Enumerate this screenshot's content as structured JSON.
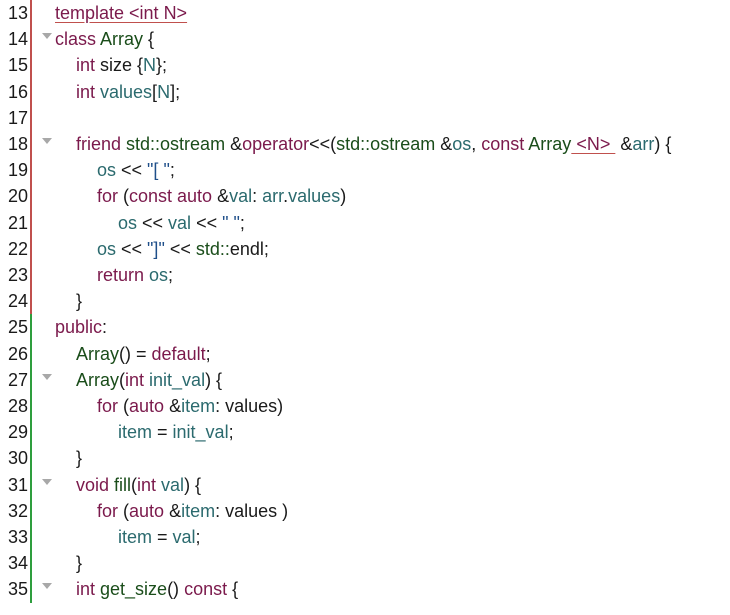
{
  "editor": {
    "lines": [
      {
        "n": "13",
        "fold": false,
        "indent": 0,
        "tokens": [
          {
            "t": "template <int N>",
            "c": "kw",
            "u": true
          }
        ]
      },
      {
        "n": "14",
        "fold": true,
        "indent": 0,
        "tokens": [
          {
            "t": "class ",
            "c": "kw"
          },
          {
            "t": "Array",
            "c": "ty"
          },
          {
            "t": " {",
            "c": "pl"
          }
        ]
      },
      {
        "n": "15",
        "fold": false,
        "indent": 1,
        "tokens": [
          {
            "t": "int ",
            "c": "kw"
          },
          {
            "t": "size ",
            "c": "pl"
          },
          {
            "t": "{",
            "c": "pl"
          },
          {
            "t": "N",
            "c": "var"
          },
          {
            "t": "};",
            "c": "pl"
          }
        ]
      },
      {
        "n": "16",
        "fold": false,
        "indent": 1,
        "tokens": [
          {
            "t": "int ",
            "c": "kw"
          },
          {
            "t": "values",
            "c": "var"
          },
          {
            "t": "[",
            "c": "pl"
          },
          {
            "t": "N",
            "c": "var"
          },
          {
            "t": "];",
            "c": "pl"
          }
        ]
      },
      {
        "n": "17",
        "fold": false,
        "indent": 0,
        "tokens": []
      },
      {
        "n": "18",
        "fold": true,
        "indent": 1,
        "tokens": [
          {
            "t": "friend ",
            "c": "kw"
          },
          {
            "t": "std::ostream ",
            "c": "ty"
          },
          {
            "t": "&",
            "c": "pl"
          },
          {
            "t": "operator",
            "c": "kw"
          },
          {
            "t": "<<(",
            "c": "pl"
          },
          {
            "t": "std::ostream ",
            "c": "ty"
          },
          {
            "t": "&",
            "c": "pl"
          },
          {
            "t": "os",
            "c": "var"
          },
          {
            "t": ", ",
            "c": "pl"
          },
          {
            "t": "const ",
            "c": "kw"
          },
          {
            "t": "Array",
            "c": "ty"
          },
          {
            "t": " <N> ",
            "c": "kw",
            "u": true
          },
          {
            "t": " &",
            "c": "pl"
          },
          {
            "t": "arr",
            "c": "var"
          },
          {
            "t": ") {",
            "c": "pl"
          }
        ]
      },
      {
        "n": "19",
        "fold": false,
        "indent": 2,
        "tokens": [
          {
            "t": "os ",
            "c": "var"
          },
          {
            "t": "<< ",
            "c": "pl"
          },
          {
            "t": "\"[ \"",
            "c": "str"
          },
          {
            "t": ";",
            "c": "pl"
          }
        ]
      },
      {
        "n": "20",
        "fold": false,
        "indent": 2,
        "tokens": [
          {
            "t": "for ",
            "c": "kw"
          },
          {
            "t": "(",
            "c": "pl"
          },
          {
            "t": "const auto ",
            "c": "kw"
          },
          {
            "t": "&",
            "c": "pl"
          },
          {
            "t": "val",
            "c": "var"
          },
          {
            "t": ": ",
            "c": "pl"
          },
          {
            "t": "arr",
            "c": "var"
          },
          {
            "t": ".",
            "c": "pl"
          },
          {
            "t": "values",
            "c": "var"
          },
          {
            "t": ")",
            "c": "pl"
          }
        ]
      },
      {
        "n": "21",
        "fold": false,
        "indent": 3,
        "tokens": [
          {
            "t": "os ",
            "c": "var"
          },
          {
            "t": "<< ",
            "c": "pl"
          },
          {
            "t": "val ",
            "c": "var"
          },
          {
            "t": "<< ",
            "c": "pl"
          },
          {
            "t": "\" \"",
            "c": "str"
          },
          {
            "t": ";",
            "c": "pl"
          }
        ]
      },
      {
        "n": "22",
        "fold": false,
        "indent": 2,
        "tokens": [
          {
            "t": "os ",
            "c": "var"
          },
          {
            "t": "<< ",
            "c": "pl"
          },
          {
            "t": "\"]\"",
            "c": "str"
          },
          {
            "t": " << ",
            "c": "pl"
          },
          {
            "t": "std::",
            "c": "ty"
          },
          {
            "t": "endl",
            "c": "pl"
          },
          {
            "t": ";",
            "c": "pl"
          }
        ]
      },
      {
        "n": "23",
        "fold": false,
        "indent": 2,
        "tokens": [
          {
            "t": "return ",
            "c": "kw"
          },
          {
            "t": "os",
            "c": "var"
          },
          {
            "t": ";",
            "c": "pl"
          }
        ]
      },
      {
        "n": "24",
        "fold": false,
        "indent": 1,
        "tokens": [
          {
            "t": "}",
            "c": "pl"
          }
        ]
      },
      {
        "n": "25",
        "fold": false,
        "indent": 0,
        "tokens": [
          {
            "t": "public",
            "c": "kw"
          },
          {
            "t": ":",
            "c": "pl"
          }
        ]
      },
      {
        "n": "26",
        "fold": false,
        "indent": 1,
        "tokens": [
          {
            "t": "Array",
            "c": "ty"
          },
          {
            "t": "() = ",
            "c": "pl"
          },
          {
            "t": "default",
            "c": "kw"
          },
          {
            "t": ";",
            "c": "pl"
          }
        ]
      },
      {
        "n": "27",
        "fold": true,
        "indent": 1,
        "tokens": [
          {
            "t": "Array",
            "c": "ty"
          },
          {
            "t": "(",
            "c": "pl"
          },
          {
            "t": "int ",
            "c": "kw"
          },
          {
            "t": "init_val",
            "c": "var"
          },
          {
            "t": ") {",
            "c": "pl"
          }
        ]
      },
      {
        "n": "28",
        "fold": false,
        "indent": 2,
        "tokens": [
          {
            "t": "for ",
            "c": "kw"
          },
          {
            "t": "(",
            "c": "pl"
          },
          {
            "t": "auto ",
            "c": "kw"
          },
          {
            "t": "&",
            "c": "pl"
          },
          {
            "t": "item",
            "c": "var"
          },
          {
            "t": ": values)",
            "c": "pl"
          }
        ]
      },
      {
        "n": "29",
        "fold": false,
        "indent": 3,
        "tokens": [
          {
            "t": "item ",
            "c": "var"
          },
          {
            "t": "= ",
            "c": "pl"
          },
          {
            "t": "init_val",
            "c": "var"
          },
          {
            "t": ";",
            "c": "pl"
          }
        ]
      },
      {
        "n": "30",
        "fold": false,
        "indent": 1,
        "tokens": [
          {
            "t": "}",
            "c": "pl"
          }
        ]
      },
      {
        "n": "31",
        "fold": true,
        "indent": 1,
        "tokens": [
          {
            "t": "void ",
            "c": "kw"
          },
          {
            "t": "fill",
            "c": "ty"
          },
          {
            "t": "(",
            "c": "pl"
          },
          {
            "t": "int ",
            "c": "kw"
          },
          {
            "t": "val",
            "c": "var"
          },
          {
            "t": ") {",
            "c": "pl"
          }
        ]
      },
      {
        "n": "32",
        "fold": false,
        "indent": 2,
        "tokens": [
          {
            "t": "for ",
            "c": "kw"
          },
          {
            "t": "(",
            "c": "pl"
          },
          {
            "t": "auto ",
            "c": "kw"
          },
          {
            "t": "&",
            "c": "pl"
          },
          {
            "t": "item",
            "c": "var"
          },
          {
            "t": ": values )",
            "c": "pl"
          }
        ]
      },
      {
        "n": "33",
        "fold": false,
        "indent": 3,
        "tokens": [
          {
            "t": "item ",
            "c": "var"
          },
          {
            "t": "= ",
            "c": "pl"
          },
          {
            "t": "val",
            "c": "var"
          },
          {
            "t": ";",
            "c": "pl"
          }
        ]
      },
      {
        "n": "34",
        "fold": false,
        "indent": 1,
        "tokens": [
          {
            "t": "}",
            "c": "pl"
          }
        ]
      },
      {
        "n": "35",
        "fold": true,
        "indent": 1,
        "tokens": [
          {
            "t": "int ",
            "c": "kw"
          },
          {
            "t": "get_size",
            "c": "ty"
          },
          {
            "t": "() ",
            "c": "pl"
          },
          {
            "t": "const",
            "c": "kw"
          },
          {
            "t": " {",
            "c": "pl"
          }
        ]
      }
    ],
    "change_bar": {
      "red_lines": [
        "13",
        "14",
        "15",
        "16",
        "17",
        "18",
        "19",
        "20",
        "21",
        "22",
        "23",
        "24"
      ],
      "green_lines": [
        "25",
        "26",
        "27",
        "28",
        "29",
        "30",
        "31",
        "32",
        "33",
        "34",
        "35"
      ]
    },
    "colors": {
      "keyword": "#7b1a4c",
      "type": "#1a4d1a",
      "variable": "#2b6a6e",
      "string": "#1f4f8a",
      "change_modified": "#c0504d",
      "change_added": "#2e9e3e"
    },
    "fold_icon": "triangle-down-icon"
  }
}
